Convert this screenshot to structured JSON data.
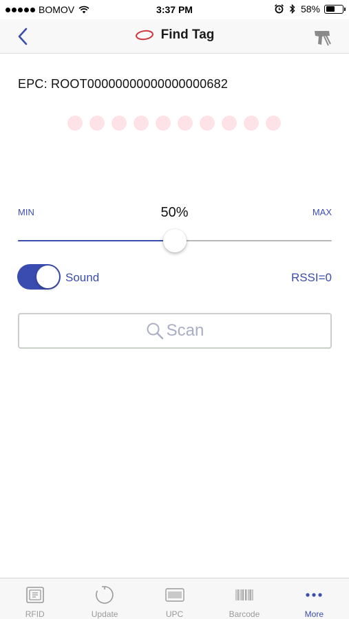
{
  "status_bar": {
    "carrier": "BOMOV",
    "time": "3:37 PM",
    "battery_percent_text": "58%",
    "battery_level": 0.58
  },
  "nav": {
    "title": "Find Tag",
    "back_icon": "chevron-left-icon",
    "right_icon": "rfid-scanner-icon"
  },
  "epc": {
    "text": "EPC: ROOT00000000000000000682"
  },
  "signal_indicator": {
    "dot_count": 10,
    "dot_color": "#fde3e7"
  },
  "power": {
    "min_label": "MIN",
    "max_label": "MAX",
    "value_text": "50%",
    "level": 0.5
  },
  "sound": {
    "label": "Sound",
    "enabled": true
  },
  "rssi": {
    "text": "RSSI=0"
  },
  "scan_button": {
    "label": "Scan",
    "icon": "search-icon"
  },
  "tabs": [
    {
      "label": "RFID",
      "icon": "rfid-icon",
      "active": false
    },
    {
      "label": "Update",
      "icon": "refresh-icon",
      "active": false
    },
    {
      "label": "UPC",
      "icon": "upc-icon",
      "active": false
    },
    {
      "label": "Barcode",
      "icon": "barcode-icon",
      "active": false
    },
    {
      "label": "More",
      "icon": "more-dots-icon",
      "active": true
    }
  ],
  "colors": {
    "accent": "#3b4cb0",
    "inactive_tab": "#9a9a9a",
    "logo_red": "#d0343a"
  }
}
